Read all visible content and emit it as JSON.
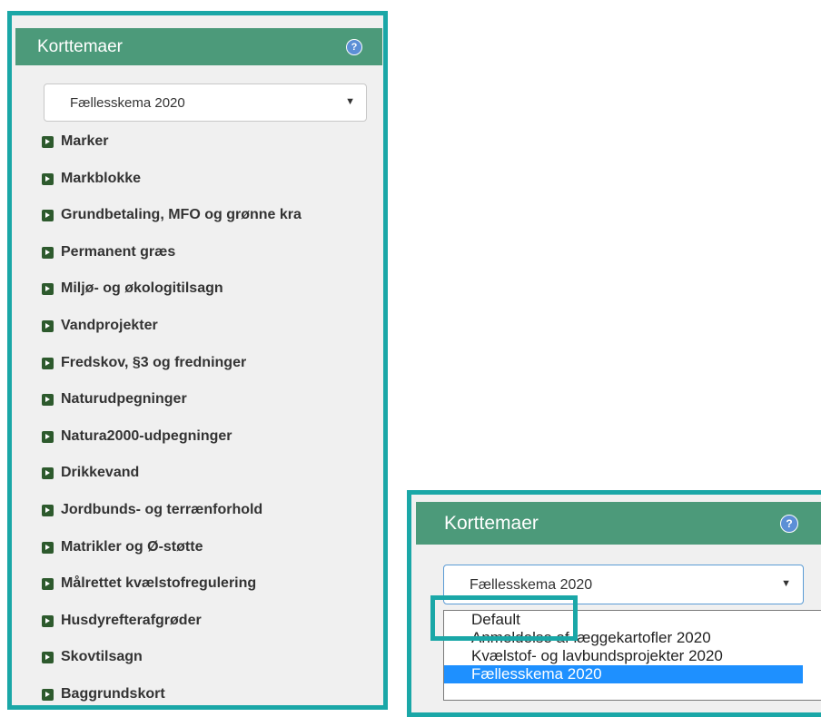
{
  "colors": {
    "accent_border": "#1aa7a7",
    "header_bg": "#4c9a7a",
    "selected_bg": "#1e90ff",
    "panel_bg": "#f0f0f0"
  },
  "left_panel": {
    "title": "Korttemaer",
    "help_icon": "question-icon",
    "help_glyph": "?",
    "select_value": "Fællesskema 2020",
    "caret": "▼",
    "items": [
      {
        "label": "Marker"
      },
      {
        "label": "Markblokke"
      },
      {
        "label": "Grundbetaling, MFO og grønne kra"
      },
      {
        "label": "Permanent græs"
      },
      {
        "label": "Miljø- og økologitilsagn"
      },
      {
        "label": "Vandprojekter"
      },
      {
        "label": "Fredskov, §3 og fredninger"
      },
      {
        "label": "Naturudpegninger"
      },
      {
        "label": "Natura2000-udpegninger"
      },
      {
        "label": "Drikkevand"
      },
      {
        "label": "Jordbunds- og terrænforhold"
      },
      {
        "label": "Matrikler og Ø-støtte"
      },
      {
        "label": "Målrettet kvælstofregulering"
      },
      {
        "label": "Husdyrefterafgrøder"
      },
      {
        "label": "Skovtilsagn"
      },
      {
        "label": "Baggrundskort"
      }
    ]
  },
  "right_panel": {
    "title": "Korttemaer",
    "help_glyph": "?",
    "select_value": "Fællesskema 2020",
    "caret": "▼",
    "options": [
      {
        "label": "Default"
      },
      {
        "label": "Anmeldelse af læggekartofler 2020"
      },
      {
        "label": "Kvælstof- og lavbundsprojekter 2020"
      },
      {
        "label": "Fællesskema 2020",
        "selected": true
      }
    ]
  }
}
